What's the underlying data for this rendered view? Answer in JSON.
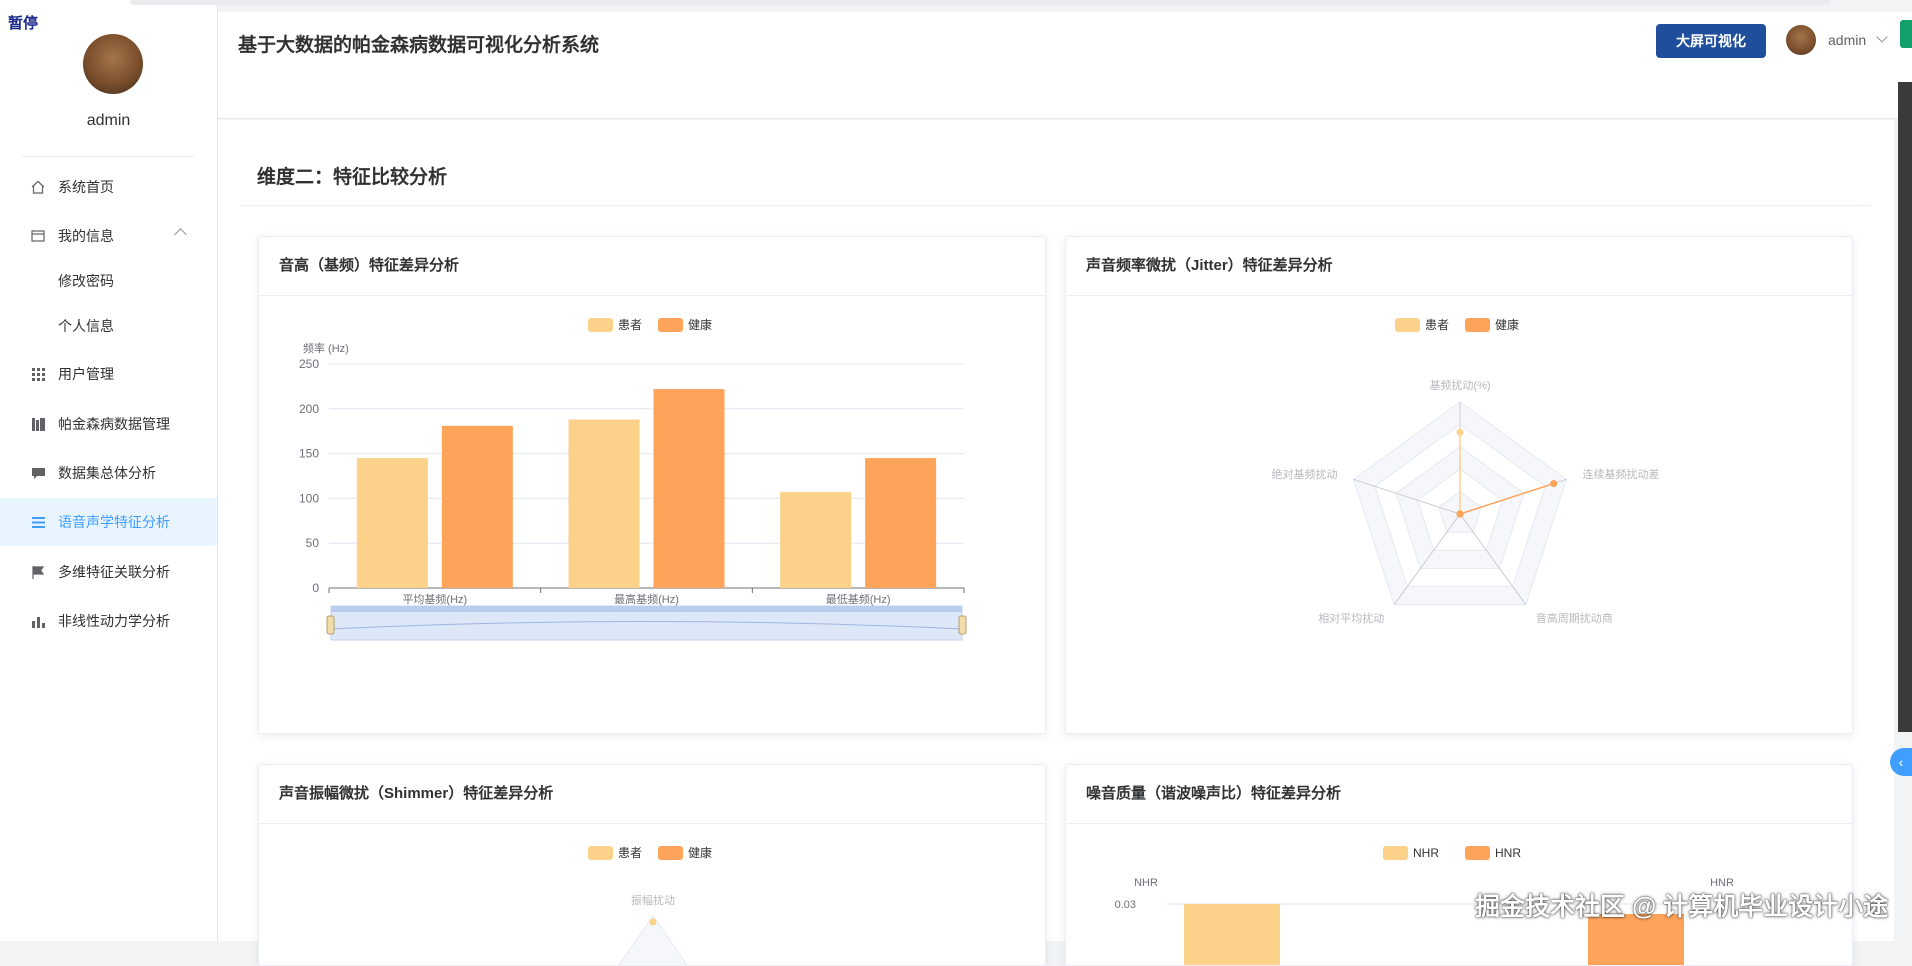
{
  "overlay": {
    "pause_label": "暂停",
    "watermark": "掘金技术社区 @ 计算机毕业设计小途"
  },
  "sidebar": {
    "username": "admin",
    "items": [
      {
        "label": "系统首页",
        "icon": "home-icon"
      },
      {
        "label": "我的信息",
        "icon": "id-card-icon"
      },
      {
        "label": "修改密码",
        "icon": ""
      },
      {
        "label": "个人信息",
        "icon": ""
      },
      {
        "label": "用户管理",
        "icon": "grid-icon"
      },
      {
        "label": "帕金森病数据管理",
        "icon": "folder-icon"
      },
      {
        "label": "数据集总体分析",
        "icon": "chat-icon"
      },
      {
        "label": "语音声学特征分析",
        "icon": "list-icon"
      },
      {
        "label": "多维特征关联分析",
        "icon": "flag-icon"
      },
      {
        "label": "非线性动力学分析",
        "icon": "bar-chart-icon"
      }
    ]
  },
  "header": {
    "title": "基于大数据的帕金森病数据可视化分析系统",
    "big_screen_label": "大屏可视化",
    "username": "admin"
  },
  "main": {
    "section_title": "维度二：特征比较分析",
    "cards": [
      {
        "title": "音高（基频）特征差异分析"
      },
      {
        "title": "声音频率微扰（Jitter）特征差异分析"
      },
      {
        "title": "声音振幅微扰（Shimmer）特征差异分析"
      },
      {
        "title": "噪音质量（谐波噪声比）特征差异分析"
      }
    ]
  },
  "colors": {
    "patient": "#fcd28a",
    "healthy": "#fda35a",
    "active": "#409eff",
    "primary_btn": "#1f4e9b"
  },
  "chart_data": [
    {
      "type": "bar",
      "legend": [
        "患者",
        "健康"
      ],
      "ylabel": "频率 (Hz)",
      "ylim": [
        0,
        250
      ],
      "yticks": [
        "0",
        "50",
        "100",
        "150",
        "200",
        "250"
      ],
      "categories": [
        "平均基频(Hz)",
        "最高基频(Hz)",
        "最低基频(Hz)"
      ],
      "series": [
        {
          "name": "患者",
          "values": [
            145,
            188,
            107
          ]
        },
        {
          "name": "健康",
          "values": [
            181,
            222,
            145
          ]
        }
      ]
    },
    {
      "type": "radar",
      "legend": [
        "患者",
        "健康"
      ],
      "indicators": [
        "基频扰动(%)",
        "连续基频扰动差",
        "音高周期扰动商",
        "相对平均扰动",
        "绝对基频扰动"
      ],
      "series": [
        {
          "name": "患者",
          "values": [
            0.73,
            0.0,
            0.0,
            0.0,
            0.0
          ]
        },
        {
          "name": "健康",
          "values": [
            0.0,
            0.88,
            0.0,
            0.0,
            0.0
          ]
        }
      ]
    },
    {
      "type": "radar",
      "legend": [
        "患者",
        "健康"
      ],
      "indicators": [
        "振幅扰动"
      ]
    },
    {
      "type": "bar",
      "legend": [
        "NHR",
        "HNR"
      ],
      "ylabel_left": "NHR",
      "ylabel_right": "HNR",
      "yticks_left": [
        "0.03"
      ]
    }
  ]
}
